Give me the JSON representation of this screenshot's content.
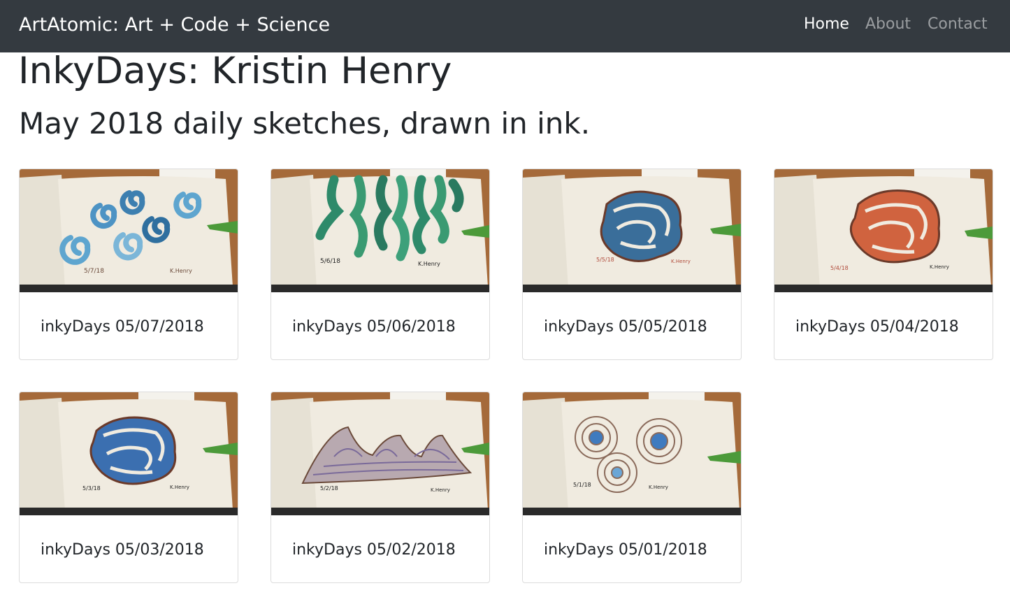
{
  "navbar": {
    "brand": "ArtAtomic: Art + Code + Science",
    "links": [
      {
        "label": "Home",
        "active": true
      },
      {
        "label": "About",
        "active": false
      },
      {
        "label": "Contact",
        "active": false
      }
    ]
  },
  "page": {
    "title": "InkyDays: Kristin Henry",
    "subtitle": "May 2018 daily sketches, drawn in ink."
  },
  "cards": [
    {
      "title": "inkyDays 05/07/2018",
      "sketch": "blue spiral shells",
      "ink_color": "#3d7fb0",
      "sign_date": "5/7/18"
    },
    {
      "title": "inkyDays 05/06/2018",
      "sketch": "green wavy tentacles",
      "ink_color": "#2e8a6a",
      "sign_date": "5/6/18"
    },
    {
      "title": "inkyDays 05/05/2018",
      "sketch": "multicolor maze blob",
      "ink_color": "#3a6e9a",
      "sign_date": "5/5/18"
    },
    {
      "title": "inkyDays 05/04/2018",
      "sketch": "orange maze blob",
      "ink_color": "#d0633f",
      "sign_date": "5/4/18"
    },
    {
      "title": "inkyDays 05/03/2018",
      "sketch": "blue maze blob",
      "ink_color": "#3b6fb0",
      "sign_date": "5/3/18"
    },
    {
      "title": "inkyDays 05/02/2018",
      "sketch": "striped mountain peaks",
      "ink_color": "#7a6a9a",
      "sign_date": "5/2/18"
    },
    {
      "title": "inkyDays 05/01/2018",
      "sketch": "contour ripple circles",
      "ink_color": "#3f7bbf",
      "sign_date": "5/1/18"
    }
  ],
  "colors": {
    "navbar_bg": "#343a40",
    "table_wood": "#a56a3a",
    "paper": "#f0ebe0"
  }
}
